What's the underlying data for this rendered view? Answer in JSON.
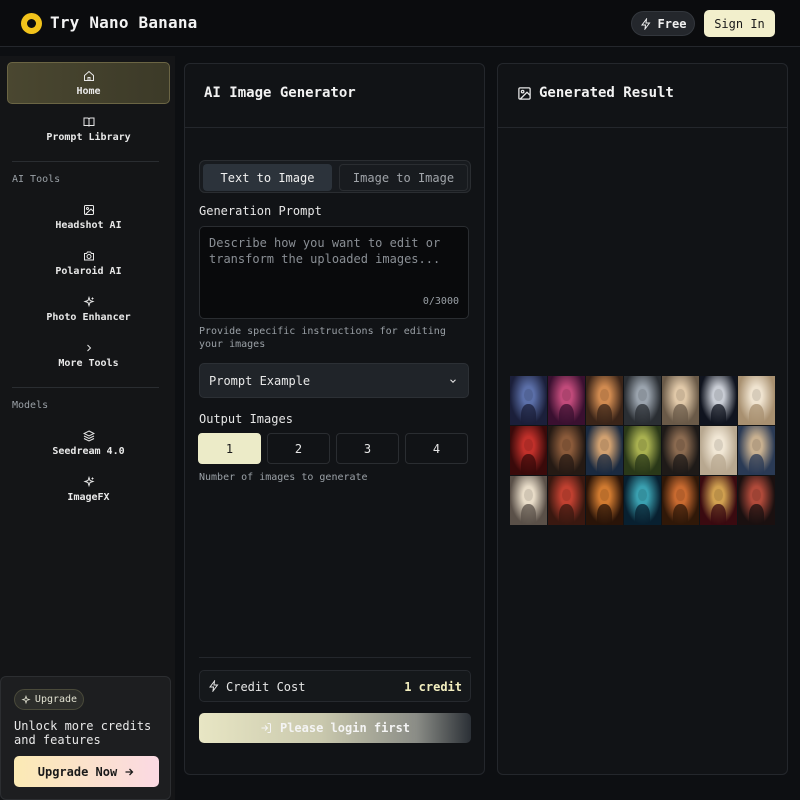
{
  "header": {
    "brand": "Try Nano Banana",
    "free_label": "Free",
    "signin_label": "Sign In"
  },
  "sidebar": {
    "items": [
      {
        "label": "Home",
        "icon": "home-icon",
        "active": true
      },
      {
        "label": "Prompt Library",
        "icon": "book-icon"
      }
    ],
    "ai_tools_heading": "AI Tools",
    "ai_tools": [
      {
        "label": "Headshot AI",
        "icon": "image-icon"
      },
      {
        "label": "Polaroid AI",
        "icon": "camera-icon"
      },
      {
        "label": "Photo Enhancer",
        "icon": "sparkles-icon"
      },
      {
        "label": "More Tools",
        "icon": "chevron-right-icon"
      }
    ],
    "models_heading": "Models",
    "models": [
      {
        "label": "Seedream 4.0",
        "icon": "layers-icon"
      },
      {
        "label": "ImageFX",
        "icon": "sparkles-icon"
      }
    ],
    "upgrade": {
      "badge": "Upgrade",
      "text": "Unlock more credits and features",
      "button": "Upgrade Now"
    }
  },
  "generator": {
    "title": "AI Image Generator",
    "tabs": [
      "Text to Image",
      "Image to Image"
    ],
    "prompt_label": "Generation Prompt",
    "prompt_placeholder": "Describe how you want to edit or transform the uploaded images...",
    "prompt_value": "",
    "char_count": "0/3000",
    "prompt_hint": "Provide specific instructions for editing your images",
    "prompt_example": "Prompt Example",
    "output_label": "Output Images",
    "output_options": [
      "1",
      "2",
      "3",
      "4"
    ],
    "output_selected": "1",
    "output_hint": "Number of images to generate",
    "credit_label": "Credit Cost",
    "credit_value": "1 credit",
    "login_button": "Please login first"
  },
  "result": {
    "title": "Generated Result",
    "thumbnails": [
      {
        "c1": "#1b1f3a",
        "c2": "#5b6fa8"
      },
      {
        "c1": "#3a1030",
        "c2": "#c04a7a"
      },
      {
        "c1": "#3a2418",
        "c2": "#d08a50"
      },
      {
        "c1": "#2a2e33",
        "c2": "#9aa3ad"
      },
      {
        "c1": "#6a5a48",
        "c2": "#e0c8a8"
      },
      {
        "c1": "#10141f",
        "c2": "#c8ccd4"
      },
      {
        "c1": "#a89070",
        "c2": "#efe3cf"
      },
      {
        "c1": "#3a0a0a",
        "c2": "#c0302a"
      },
      {
        "c1": "#251a14",
        "c2": "#8a5a3a"
      },
      {
        "c1": "#1a2a40",
        "c2": "#d0a070"
      },
      {
        "c1": "#2a3818",
        "c2": "#a8b050"
      },
      {
        "c1": "#1e1a18",
        "c2": "#8a6a50"
      },
      {
        "c1": "#b8a890",
        "c2": "#f0e6d4"
      },
      {
        "c1": "#2a3a55",
        "c2": "#c8b090"
      },
      {
        "c1": "#5a5048",
        "c2": "#e8dcc8"
      },
      {
        "c1": "#3a1810",
        "c2": "#c04030"
      },
      {
        "c1": "#2a1408",
        "c2": "#d07a30"
      },
      {
        "c1": "#082030",
        "c2": "#3aa0b0"
      },
      {
        "c1": "#301808",
        "c2": "#c86a30"
      },
      {
        "c1": "#3a0a10",
        "c2": "#d0a050"
      },
      {
        "c1": "#1a1010",
        "c2": "#b04a3a"
      }
    ]
  }
}
